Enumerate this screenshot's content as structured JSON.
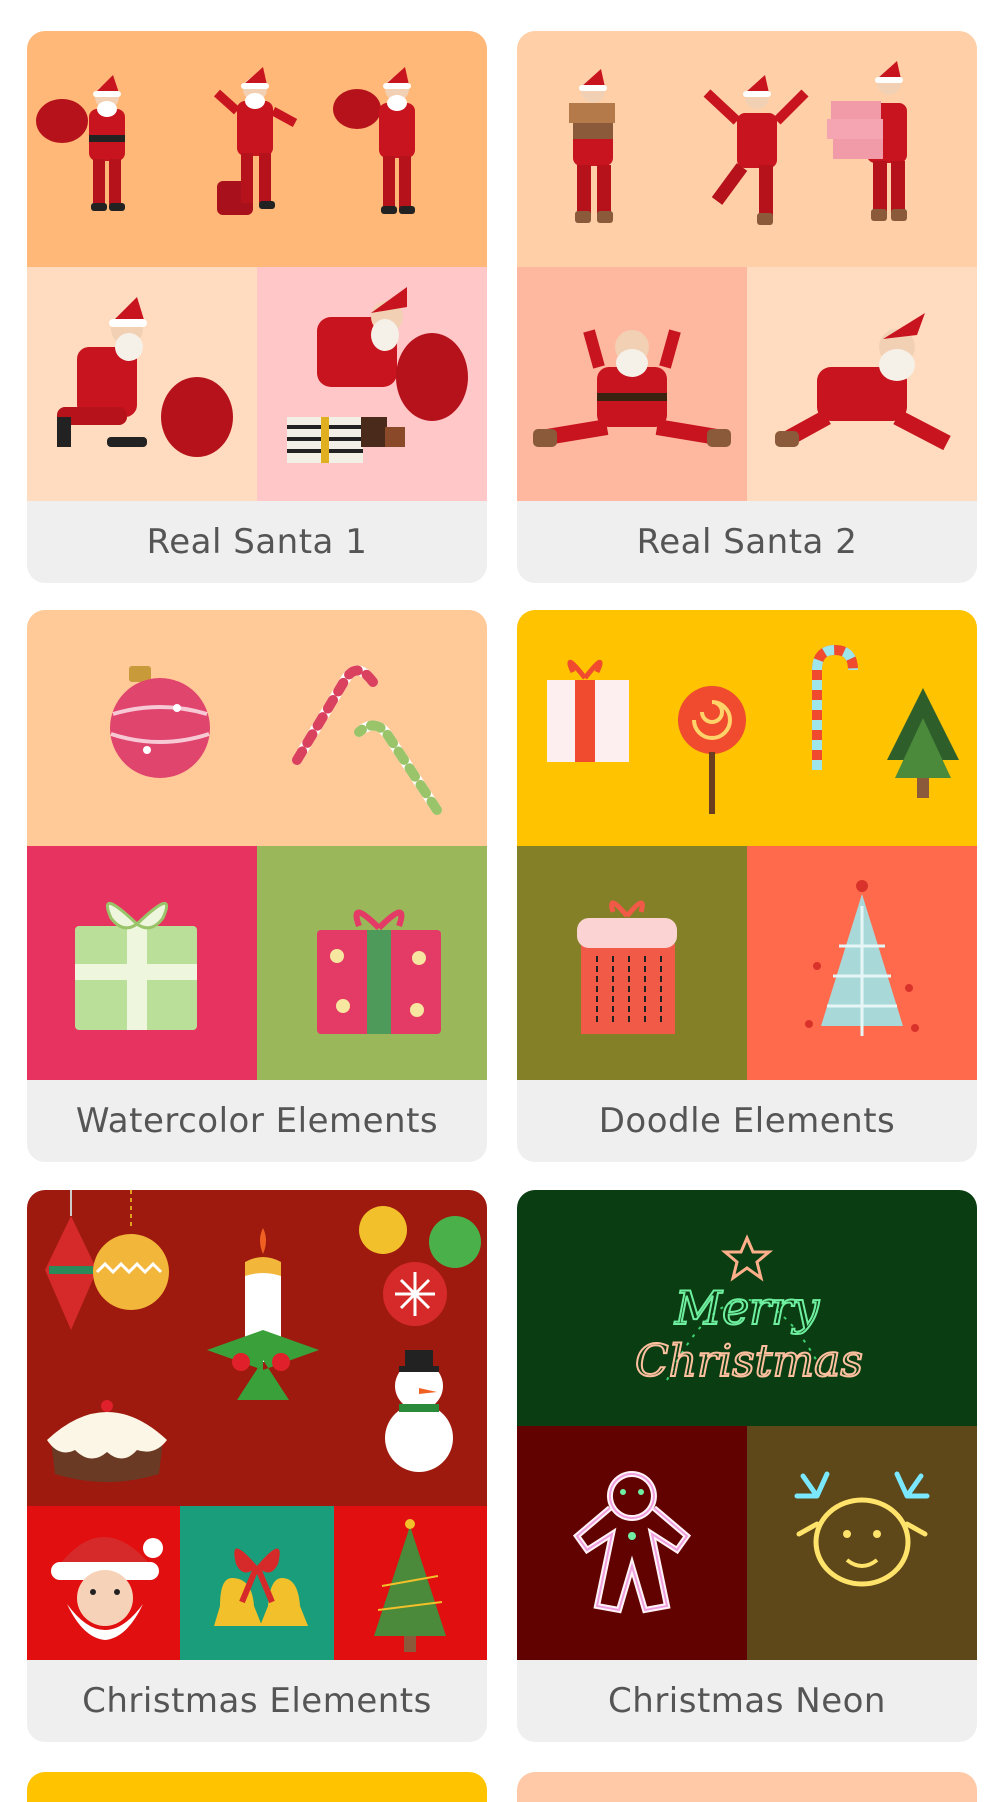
{
  "cards": [
    {
      "title": "Real Santa 1"
    },
    {
      "title": "Real Santa 2"
    },
    {
      "title": "Watercolor Elements"
    },
    {
      "title": "Doodle Elements"
    },
    {
      "title": "Christmas Elements"
    },
    {
      "title": "Christmas Neon"
    }
  ],
  "neon_text": {
    "line1": "Merry",
    "line2": "Christmas"
  },
  "colors": {
    "orange": "#ffb878",
    "peach": "#ffdcbf",
    "pink": "#ffc7c8",
    "salmon": "#ffb8a0",
    "raspberry": "#e63360",
    "olive_green": "#9ab85a",
    "yellow": "#ffc300",
    "olive": "#848027",
    "coral": "#ff6a4d",
    "dark_red": "#9e1a0e",
    "red": "#e10f0f",
    "teal": "#1a9d7a",
    "dark_green": "#0a3d12",
    "maroon": "#610201",
    "brown": "#5e4719",
    "caption_bg": "#efefef",
    "caption_text": "#555555"
  }
}
